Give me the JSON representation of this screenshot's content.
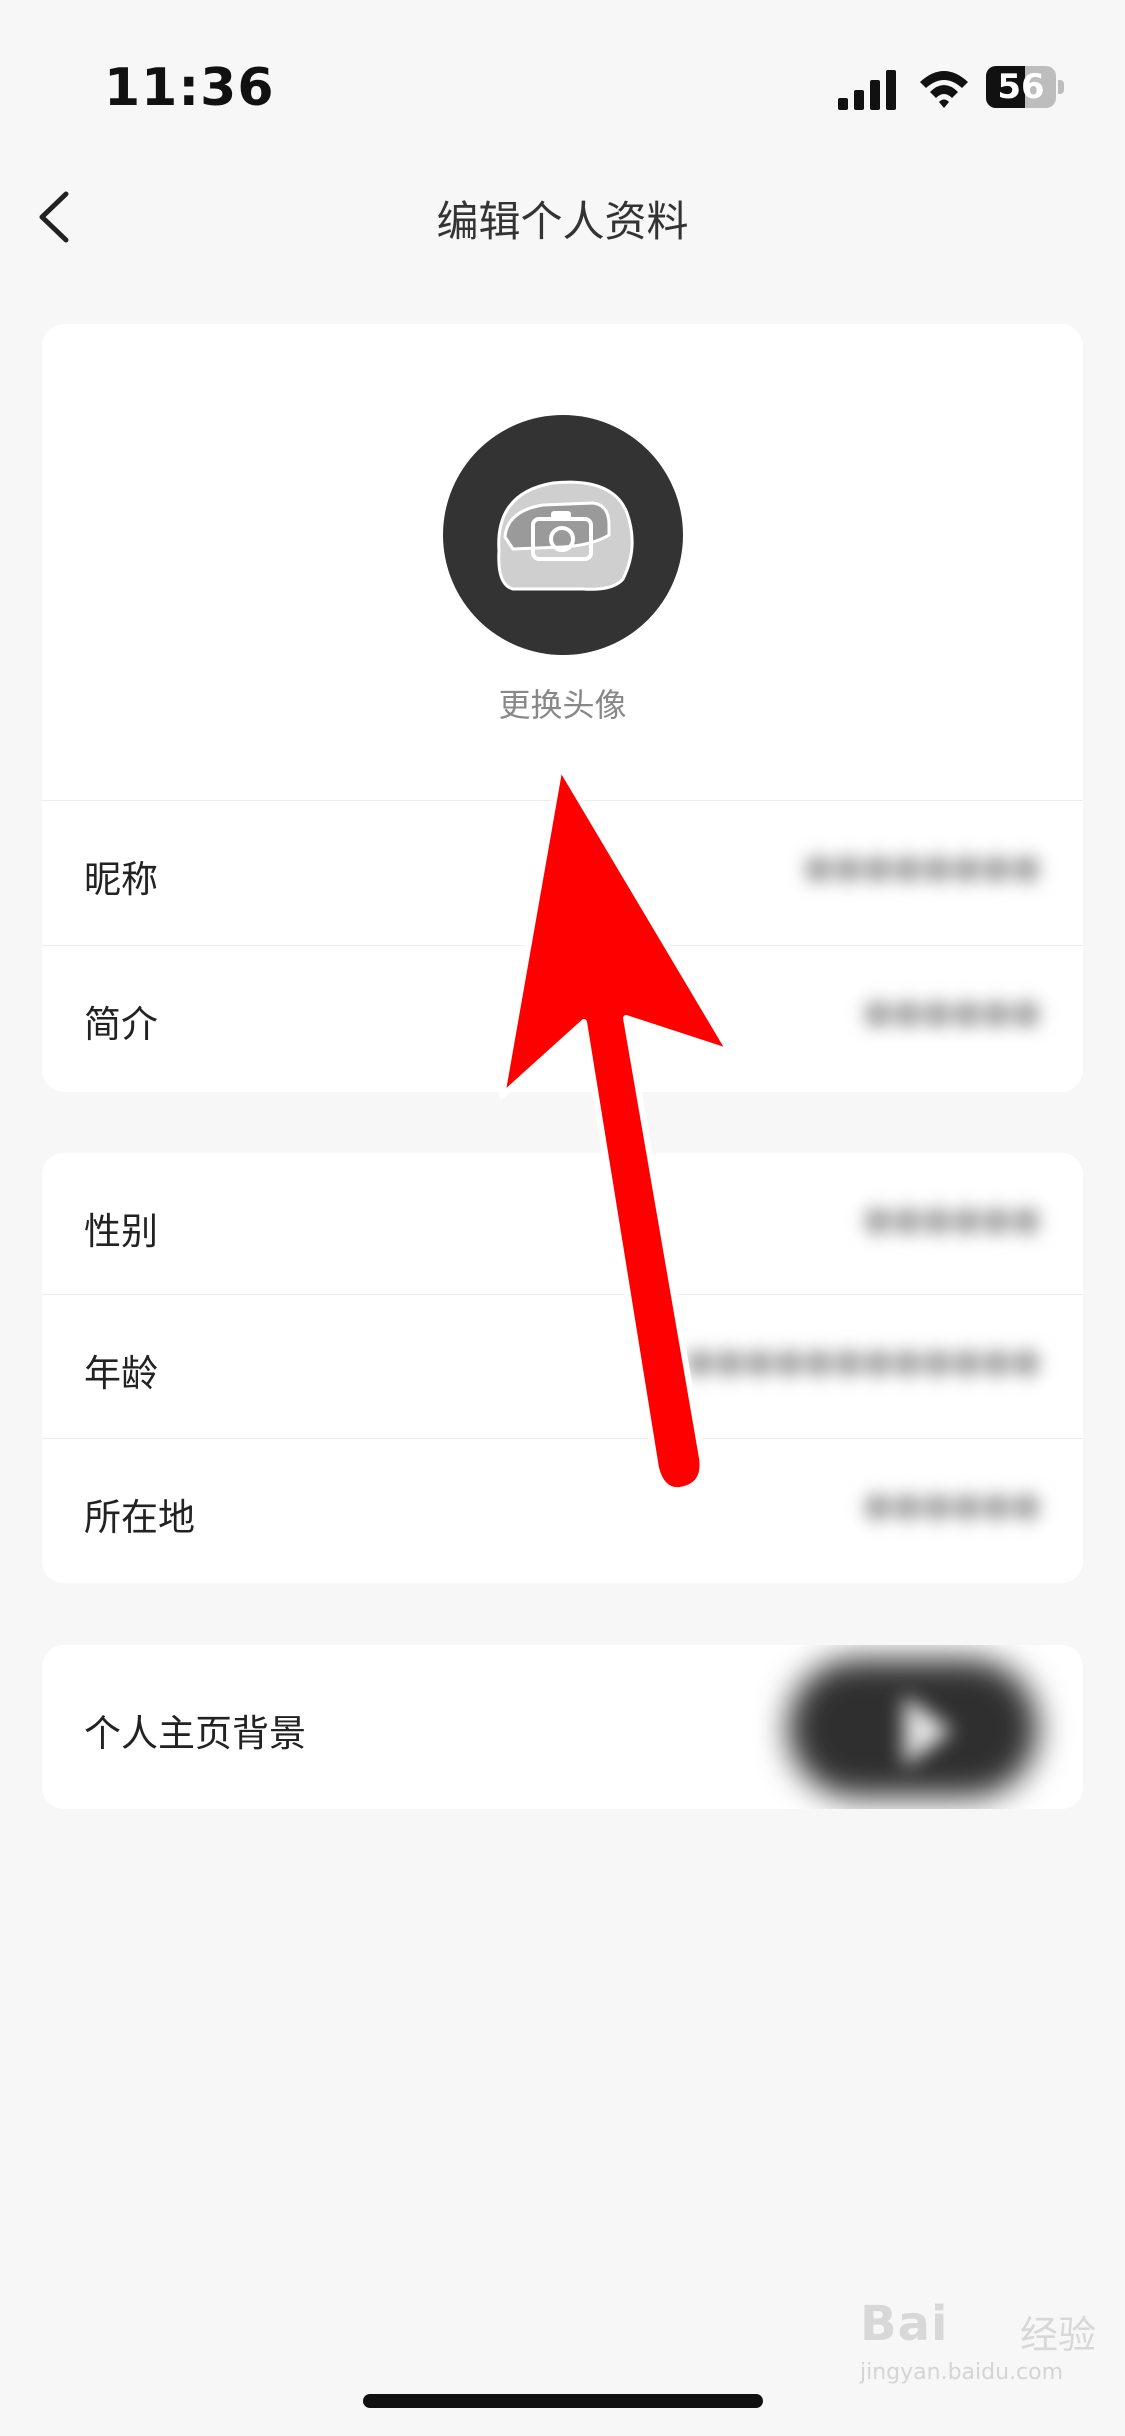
{
  "status_bar": {
    "time": "11:36",
    "battery": "56",
    "battery_level": 0.56
  },
  "nav": {
    "title": "编辑个人资料",
    "back_icon": "chevron-left-icon"
  },
  "profile": {
    "avatar_icon": "helmet-camera-icon",
    "avatar_caption": "更换头像"
  },
  "rows": {
    "nickname": {
      "label": "昵称"
    },
    "bio": {
      "label": "简介"
    },
    "gender": {
      "label": "性别"
    },
    "age": {
      "label": "年龄"
    },
    "location": {
      "label": "所在地"
    },
    "background": {
      "label": "个人主页背景"
    }
  },
  "annotation": {
    "color": "#ff0000"
  },
  "watermark": {
    "logo": "Bai",
    "logo_cn": "经验",
    "sub": "jingyan.baidu.com"
  },
  "colors": {
    "page_bg": "#f7f7f7",
    "card_bg": "#ffffff",
    "avatar_bg": "#333333",
    "caption": "#888888"
  }
}
